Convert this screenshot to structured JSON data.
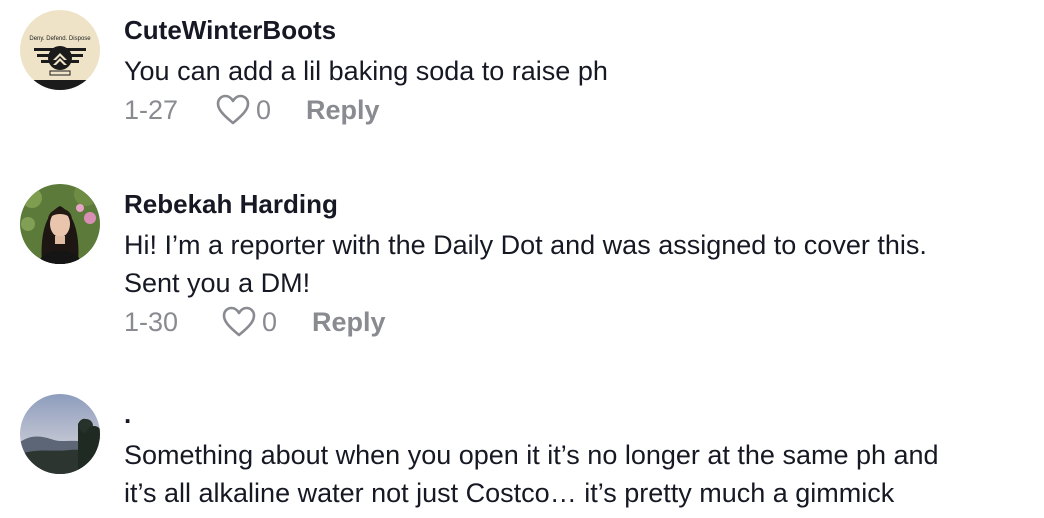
{
  "comments": [
    {
      "username": "CuteWinterBoots",
      "avatar_icon": "deny-defend-dispose-badge-icon",
      "avatar_badge_text": "Deny. Defend. Dispose",
      "lines": [
        "You can add a lil baking soda to raise ph"
      ],
      "date": "1-27",
      "likes": "0",
      "reply_label": "Reply"
    },
    {
      "username": "Rebekah Harding",
      "avatar_icon": "profile-photo-icon",
      "lines": [
        "Hi! I’m a reporter with the Daily Dot and was assigned to cover this.",
        "Sent you a DM!"
      ],
      "date": "1-30",
      "likes": "0",
      "reply_label": "Reply"
    },
    {
      "username": ".",
      "avatar_icon": "landscape-photo-icon",
      "lines": [
        "Something about when you open it it’s no longer at the same ph and",
        "it’s all alkaline water not just Costco… it’s pretty much a gimmick"
      ]
    }
  ],
  "colors": {
    "text": "#161823",
    "muted": "#8a8b91",
    "background": "#ffffff"
  }
}
